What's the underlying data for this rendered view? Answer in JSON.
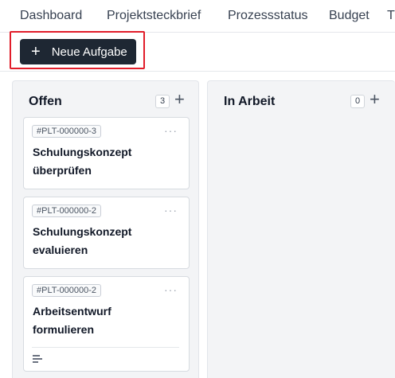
{
  "tabs": [
    {
      "label": "Dashboard"
    },
    {
      "label": "Projektsteckbrief"
    },
    {
      "label": "Prozessstatus"
    },
    {
      "label": "Budget"
    },
    {
      "label": "T"
    }
  ],
  "toolbar": {
    "new_task_label": "Neue Aufgabe",
    "plus_glyph": "+"
  },
  "columns": [
    {
      "title": "Offen",
      "count": "3",
      "add_glyph": "+",
      "cards": [
        {
          "id": "#PLT-000000-3",
          "title": "Schulungskonzept überprüfen",
          "menu": "···"
        },
        {
          "id": "#PLT-000000-2",
          "title": "Schulungskonzept evaluieren",
          "menu": "···"
        },
        {
          "id": "#PLT-000000-2",
          "title": "Arbeitsentwurf formulieren",
          "menu": "···",
          "has_description_icon": true
        }
      ]
    },
    {
      "title": "In Arbeit",
      "count": "0",
      "add_glyph": "+",
      "cards": []
    }
  ],
  "colors": {
    "primary_button": "#1e2733",
    "highlight": "#e11d2a",
    "column_bg": "#f3f4f6"
  }
}
